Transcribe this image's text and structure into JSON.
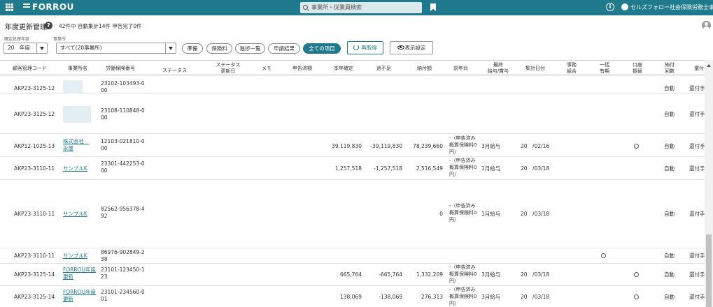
{
  "app": {
    "logo": "FORROU",
    "search_placeholder": "事業所・従業員検索",
    "user_name": "セルズフォロー社会保険労務士事務..."
  },
  "page": {
    "title": "年度更新管理",
    "count_text": "42件中 自動集計14件 申告完了0件"
  },
  "filters": {
    "year_label": "確定処理年度",
    "year_value": "20　年度",
    "office_label": "事業所",
    "office_value": "すべて(20事業所)"
  },
  "toolbar": {
    "pills": [
      "準備",
      "保険料",
      "進捗一覧",
      "申請結果",
      "全ての項目"
    ],
    "active_pill": "全ての項目",
    "refresh_label": "再取得",
    "display_settings_label": "表示設定"
  },
  "table": {
    "headers": [
      "顧客管理コード",
      "事業所名",
      "労働保険番号",
      "ステータス",
      "ステータス\n更新日",
      "メモ",
      "申告済額",
      "本年確定",
      "過不足",
      "納付額",
      "前年比",
      "最終\n給与/賞与",
      "集計日付",
      "事務\n組合",
      "一括\n有期",
      "口座\n振替",
      "納付\n回数",
      "還付手"
    ],
    "rows": [
      {
        "code": "AKP23-3125-12",
        "office": "",
        "insurance_no": "23102-103493-000",
        "confirmed": "",
        "diff": "",
        "payment": "",
        "prev": "",
        "last_pay": "",
        "agg_date": "",
        "bulk": false,
        "account": false,
        "times": "自動",
        "refund": "還付手"
      },
      {
        "code": "AKP23-3125-12",
        "office": "",
        "insurance_no": "23108-110848-000",
        "confirmed": "",
        "diff": "",
        "payment": "",
        "prev": "",
        "last_pay": "",
        "agg_date": "",
        "bulk": false,
        "account": false,
        "times": "自動",
        "refund": "還付手"
      },
      {
        "code": "AKP12-1025-13",
        "office": "株式会社　永屋",
        "insurance_no": "12103-021810-000",
        "confirmed": "39,119,830",
        "diff": "-39,119,830",
        "payment": "78,239,660",
        "prev": "-（申告済み概算保険料0円）",
        "last_pay": "3月給与",
        "agg_date": "20　/02/16",
        "bulk": false,
        "account": true,
        "times": "自動",
        "refund": "還付手"
      },
      {
        "code": "AKP23-3110-11",
        "office": "サンプルK",
        "insurance_no": "23301-442253-000",
        "confirmed": "1,257,518",
        "diff": "-1,257,518",
        "payment": "2,516,549",
        "prev": "-（申告済み概算保険料0円）",
        "last_pay": "1月給与",
        "agg_date": "20　/03/18",
        "bulk": false,
        "account": false,
        "times": "自動",
        "refund": "還付手"
      },
      {
        "code": "AKP23-3110-11",
        "office": "サンプルK",
        "insurance_no": "82562-956378-492",
        "confirmed": "",
        "diff": "",
        "payment": "0",
        "prev": "-（申告済み概算保険料0円）",
        "last_pay": "1月給与",
        "agg_date": "20　/03/18",
        "bulk": false,
        "account": false,
        "times": "自動",
        "refund": "還付手"
      },
      {
        "code": "AKP23-3110-11",
        "office": "サンプルK",
        "insurance_no": "86976-902849-238",
        "confirmed": "",
        "diff": "",
        "payment": "",
        "prev": "",
        "last_pay": "",
        "agg_date": "",
        "bulk": true,
        "account": false,
        "times": "自動",
        "refund": "還付手"
      },
      {
        "code": "AKP23-3125-14",
        "office": "FORROU年度更新",
        "insurance_no": "23101-123450-123",
        "confirmed": "665,764",
        "diff": "-665,764",
        "payment": "1,332,209",
        "prev": "-（申告済み概算保険料0円）",
        "last_pay": "3月給与",
        "agg_date": "20　/03/18",
        "bulk": false,
        "account": true,
        "times": "自動",
        "refund": "還付手"
      },
      {
        "code": "AKP23-3125-14",
        "office": "FORROU年度更新",
        "insurance_no": "23101-234560-001",
        "confirmed": "138,069",
        "diff": "-138,069",
        "payment": "276,313",
        "prev": "-（申告済み概算保険料0円）",
        "last_pay": "3月給与",
        "agg_date": "20　/03/18",
        "bulk": false,
        "account": true,
        "times": "自動",
        "refund": "還付手"
      }
    ]
  }
}
